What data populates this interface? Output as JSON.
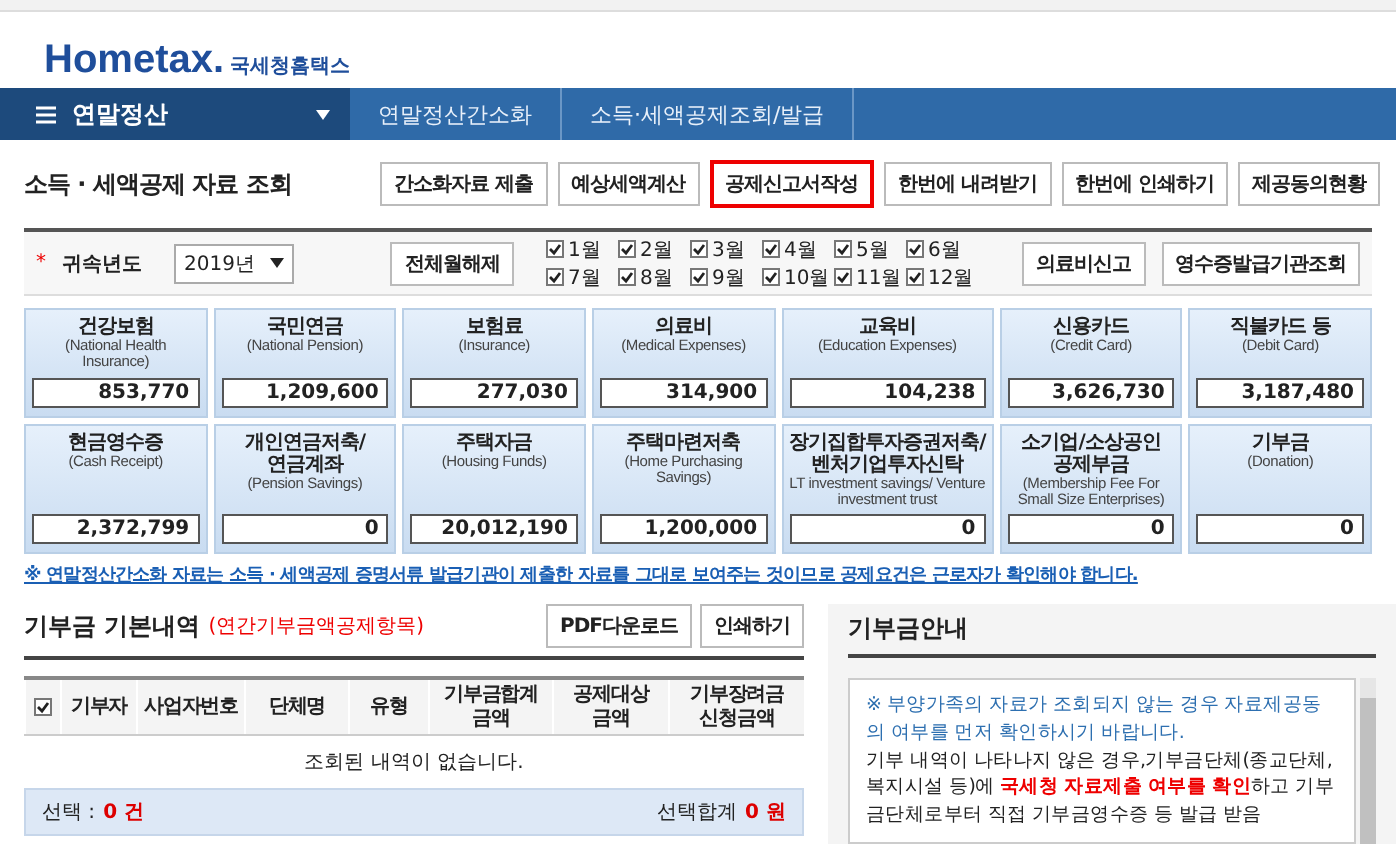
{
  "logo": {
    "brand": "Hometax.",
    "org": "국세청홈택스"
  },
  "nav": {
    "menu": "연말정산",
    "breadcrumbs": [
      "연말정산간소화",
      "소득·세액공제조회/발급"
    ]
  },
  "page_title": "소득 · 세액공제 자료 조회",
  "actions": [
    {
      "label": "간소화자료 제출",
      "selected": false
    },
    {
      "label": "예상세액계산",
      "selected": false
    },
    {
      "label": "공제신고서작성",
      "selected": true
    },
    {
      "label": "한번에 내려받기",
      "selected": false
    },
    {
      "label": "한번에 인쇄하기",
      "selected": false
    },
    {
      "label": "제공동의현황",
      "selected": false
    }
  ],
  "filter": {
    "required_mark": "*",
    "label": "귀속년도",
    "year": "2019년",
    "clear_button": "전체월해제",
    "months": [
      {
        "label": "1월",
        "checked": true
      },
      {
        "label": "2월",
        "checked": true
      },
      {
        "label": "3월",
        "checked": true
      },
      {
        "label": "4월",
        "checked": true
      },
      {
        "label": "5월",
        "checked": true
      },
      {
        "label": "6월",
        "checked": true
      },
      {
        "label": "7월",
        "checked": true
      },
      {
        "label": "8월",
        "checked": true
      },
      {
        "label": "9월",
        "checked": true
      },
      {
        "label": "10월",
        "checked": true
      },
      {
        "label": "11월",
        "checked": true
      },
      {
        "label": "12월",
        "checked": true
      }
    ],
    "buttons": [
      "의료비신고",
      "영수증발급기관조회"
    ]
  },
  "tiles": [
    {
      "title": "건강보험",
      "subtitle": "(National Health Insurance)",
      "value": "853,770"
    },
    {
      "title": "국민연금",
      "subtitle": "(National Pension)",
      "value": "1,209,600"
    },
    {
      "title": "보험료",
      "subtitle": "(Insurance)",
      "value": "277,030"
    },
    {
      "title": "의료비",
      "subtitle": "(Medical Expenses)",
      "value": "314,900"
    },
    {
      "title": "교육비",
      "subtitle": "(Education Expenses)",
      "value": "104,238"
    },
    {
      "title": "신용카드",
      "subtitle": "(Credit Card)",
      "value": "3,626,730"
    },
    {
      "title": "직불카드 등",
      "subtitle": "(Debit Card)",
      "value": "3,187,480"
    },
    {
      "title": "현금영수증",
      "subtitle": "(Cash Receipt)",
      "value": "2,372,799"
    },
    {
      "title": "개인연금저축/연금계좌",
      "subtitle": "(Pension Savings)",
      "value": "0"
    },
    {
      "title": "주택자금",
      "subtitle": "(Housing Funds)",
      "value": "20,012,190"
    },
    {
      "title": "주택마련저축",
      "subtitle": "(Home Purchasing Savings)",
      "value": "1,200,000"
    },
    {
      "title": "장기집합투자증권저축/벤처기업투자신탁",
      "subtitle": "LT investment savings/ Venture investment trust",
      "value": "0"
    },
    {
      "title": "소기업/소상공인 공제부금",
      "subtitle": "(Membership Fee For Small Size Enterprises)",
      "value": "0"
    },
    {
      "title": "기부금",
      "subtitle": "(Donation)",
      "value": "0"
    }
  ],
  "notice": "※ 연말정산간소화 자료는 소득 · 세액공제 증명서류 발급기관이 제출한 자료를 그대로 보여주는 것이므로 공제요건은 근로자가 확인해야 합니다.",
  "donation": {
    "title": "기부금 기본내역",
    "subtitle": "(연간기부금액공제항목)",
    "buttons": [
      "PDF다운로드",
      "인쇄하기"
    ],
    "select_all": {
      "checked": true
    },
    "columns": [
      "기부자",
      "사업자번호",
      "단체명",
      "유형",
      "기부금합계 금액",
      "공제대상 금액",
      "기부장려금 신청금액"
    ],
    "empty_message": "조회된 내역이 없습니다.",
    "footer": {
      "count_label": "선택 :",
      "count": "0 건",
      "sum_label": "선택합계",
      "sum": "0 원"
    }
  },
  "guide": {
    "title": "기부금안내",
    "notice": "※ 부양가족의 자료가 조회되지 않는 경우 자료제공동의 여부를 먼저 확인하시기 바랍니다.",
    "body": "기부 내역이 나타나지 않은 경우,기부금단체(종교단체, 복지시설 등)에 **국세청 자료제출 여부를 확인**하고 기부금단체로부터 직접 기부금영수증 등 발급 받음"
  }
}
